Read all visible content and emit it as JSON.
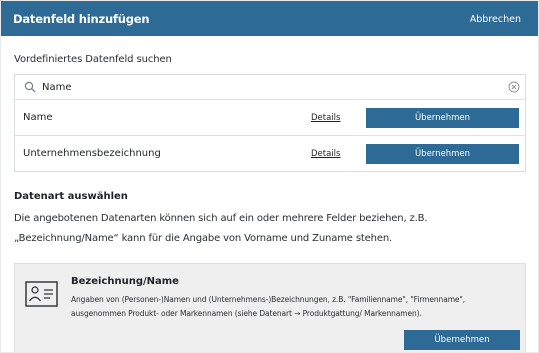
{
  "header": {
    "title": "Datenfeld hinzufügen",
    "cancel_label": "Abbrechen"
  },
  "search": {
    "label": "Vordefiniertes Datenfeld suchen",
    "value": "Name"
  },
  "results": [
    {
      "name": "Name",
      "details_label": "Details",
      "button_label": "Übernehmen"
    },
    {
      "name": "Unternehmensbezeichnung",
      "details_label": "Details",
      "button_label": "Übernehmen"
    }
  ],
  "datatype": {
    "title": "Datenart auswählen",
    "description": "Die angebotenen Datenarten können sich auf ein oder mehrere Felder beziehen, z.B. „Bezeichnung/Name“ kann für die Angabe von Vorname und Zuname stehen."
  },
  "card": {
    "icon": "id-card-icon",
    "title": "Bezeichnung/Name",
    "description": "Angaben von (Personen-)Namen und (Unternehmens-)Bezeichnungen, z.B. \"Familienname\", \"Firmenname\", ausgenommen Produkt- oder Markennamen (siehe Datenart → Produktgattung/ Markennamen).",
    "button_label": "Übernehmen"
  },
  "colors": {
    "accent": "#2e6a96",
    "card_bg": "#efefef",
    "border": "#d9dde2"
  }
}
